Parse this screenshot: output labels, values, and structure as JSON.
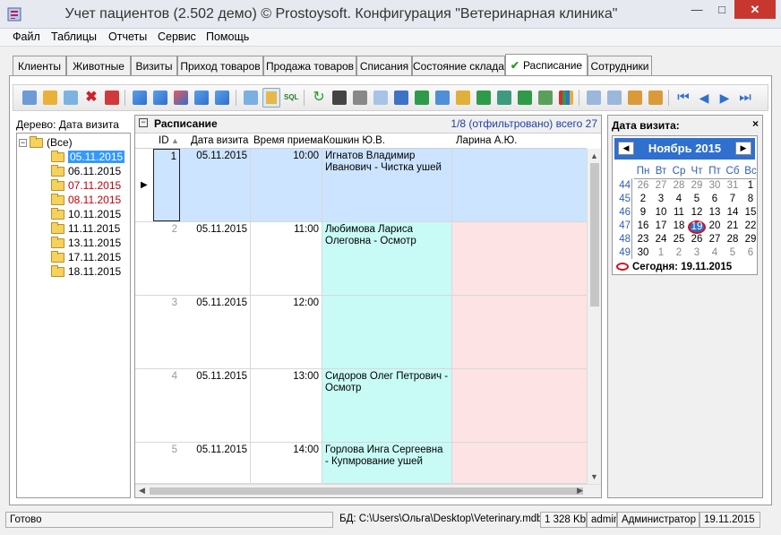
{
  "window": {
    "title": "Учет пациентов (2.502 демо) © Prostoysoft. Конфигурация \"Ветеринарная клиника\""
  },
  "menu": [
    "Файл",
    "Таблицы",
    "Отчеты",
    "Сервис",
    "Помощь"
  ],
  "tabs": [
    "Клиенты",
    "Животные",
    "Визиты",
    "Приход товаров",
    "Продажа товаров",
    "Списания",
    "Состояние склада",
    "Расписание",
    "Сотрудники"
  ],
  "tree": {
    "title": "Дерево: Дата визита",
    "root": "(Все)",
    "items": [
      "05.11.2015",
      "06.11.2015",
      "07.11.2015",
      "08.11.2015",
      "10.11.2015",
      "11.11.2015",
      "13.11.2015",
      "17.11.2015",
      "18.11.2015"
    ]
  },
  "grid": {
    "title": "Расписание",
    "filter_info": "1/8 (отфильтровано) всего 27",
    "columns": [
      "ID",
      "Дата визита",
      "Время приема",
      "Кошкин Ю.В.",
      "Ларина А.Ю."
    ],
    "rows": [
      {
        "id": "1",
        "date": "05.11.2015",
        "time": "10:00",
        "doc1": "Игнатов Владимир Иванович - Чистка ушей",
        "doc2": ""
      },
      {
        "id": "2",
        "date": "05.11.2015",
        "time": "11:00",
        "doc1": "Любимова Лариса Олеговна - Осмотр",
        "doc2": ""
      },
      {
        "id": "3",
        "date": "05.11.2015",
        "time": "12:00",
        "doc1": "",
        "doc2": ""
      },
      {
        "id": "4",
        "date": "05.11.2015",
        "time": "13:00",
        "doc1": "Сидоров Олег Петрович - Осмотр",
        "doc2": ""
      },
      {
        "id": "5",
        "date": "05.11.2015",
        "time": "14:00",
        "doc1": "Горлова Инга Сергеевна - Купмрование ушей",
        "doc2": ""
      }
    ]
  },
  "calendar": {
    "title": "Дата визита:",
    "month": "Ноябрь 2015",
    "day_names": [
      "Пн",
      "Вт",
      "Ср",
      "Чт",
      "Пт",
      "Сб",
      "Вс"
    ],
    "weeks": [
      {
        "num": "44",
        "days": [
          "26",
          "27",
          "28",
          "29",
          "30",
          "31",
          "1"
        ]
      },
      {
        "num": "45",
        "days": [
          "2",
          "3",
          "4",
          "5",
          "6",
          "7",
          "8"
        ]
      },
      {
        "num": "46",
        "days": [
          "9",
          "10",
          "11",
          "12",
          "13",
          "14",
          "15"
        ]
      },
      {
        "num": "47",
        "days": [
          "16",
          "17",
          "18",
          "19",
          "20",
          "21",
          "22"
        ]
      },
      {
        "num": "48",
        "days": [
          "23",
          "24",
          "25",
          "26",
          "27",
          "28",
          "29"
        ]
      },
      {
        "num": "49",
        "days": [
          "30",
          "1",
          "2",
          "3",
          "4",
          "5",
          "6"
        ]
      }
    ],
    "today_label": "Сегодня: 19.11.2015"
  },
  "status": {
    "ready": "Готово",
    "db_label": "БД:",
    "db_path": "C:\\Users\\Ольга\\Desktop\\Veterinary.mdb",
    "size": "1 328 Kb",
    "user": "admin",
    "role": "Администратор",
    "date": "19.11.2015"
  },
  "colors": {
    "selected_row": "#cce4ff",
    "doc1_bg": "#c8fbf5",
    "doc2_bg": "#fde3e3",
    "accent": "#2f6fce",
    "today_circle": "#d0111b"
  }
}
